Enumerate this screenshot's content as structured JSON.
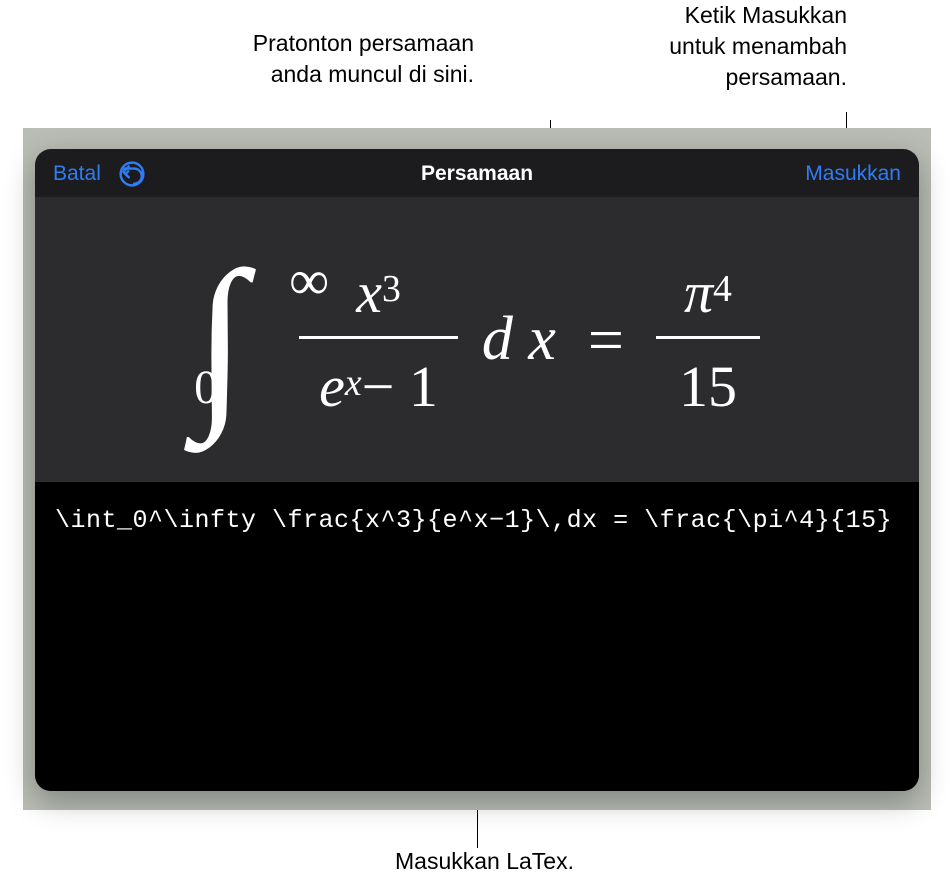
{
  "callouts": {
    "preview": "Pratonton persamaan\nanda muncul di sini.",
    "insert": "Ketik Masukkan\nuntuk menambah\npersamaan.",
    "latex": "Masukkan LaTex."
  },
  "panel": {
    "cancel_label": "Batal",
    "title": "Persamaan",
    "insert_label": "Masukkan"
  },
  "equation": {
    "int_lower": "0",
    "int_upper": "∞",
    "frac1_num_base": "x",
    "frac1_num_exp": "3",
    "frac1_den_base": "e",
    "frac1_den_exp": "x",
    "frac1_den_rest": " − 1",
    "dx": "d x",
    "equals": "=",
    "frac2_num_base": "π",
    "frac2_num_exp": "4",
    "frac2_den": "15"
  },
  "latex_source": "\\int_0^\\infty \\frac{x^3}{e^x−1}\\,dx = \\frac{\\pi^4}{15}",
  "colors": {
    "accent": "#2f7df6",
    "panel_bg": "#1c1c1e",
    "preview_bg": "#2c2c2e",
    "input_bg": "#000000"
  }
}
